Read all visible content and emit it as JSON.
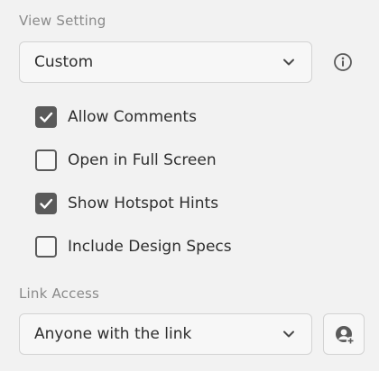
{
  "view_setting": {
    "label": "View Setting",
    "selected": "Custom",
    "info_icon": "info-icon",
    "chevron_icon": "chevron-down-icon"
  },
  "options": [
    {
      "label": "Allow Comments",
      "checked": true
    },
    {
      "label": "Open in Full Screen",
      "checked": false
    },
    {
      "label": "Show Hotspot Hints",
      "checked": true
    },
    {
      "label": "Include Design Specs",
      "checked": false
    }
  ],
  "link_access": {
    "label": "Link Access",
    "selected": "Anyone with the link",
    "chevron_icon": "chevron-down-icon",
    "add_user_icon": "add-user-icon"
  },
  "colors": {
    "background": "#f2f2f2",
    "control_fill": "#f7f7f7",
    "border": "#d3d3d3",
    "checkbox": "#5a5a5a",
    "text": "#2e2e2e",
    "muted_text": "#8a8a8a"
  }
}
